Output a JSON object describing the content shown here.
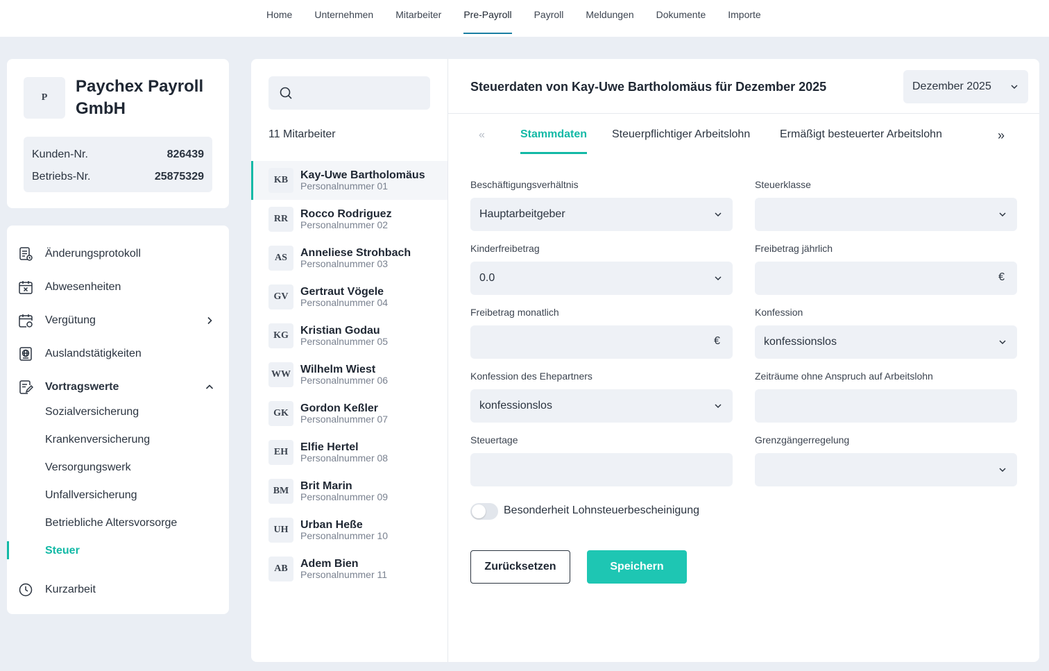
{
  "topnav": {
    "items": [
      "Home",
      "Unternehmen",
      "Mitarbeiter",
      "Pre-Payroll",
      "Payroll",
      "Meldungen",
      "Dokumente",
      "Importe"
    ],
    "active": "Pre-Payroll"
  },
  "company": {
    "logo_letter": "P",
    "name": "Paychex Payroll GmbH",
    "kunden_label": "Kunden-Nr.",
    "kunden_value": "826439",
    "betriebs_label": "Betriebs-Nr.",
    "betriebs_value": "25875329"
  },
  "side_menu": {
    "items": {
      "aenderung": "Änderungsprotokoll",
      "abwesenheiten": "Abwesenheiten",
      "verguetung": "Vergütung",
      "ausland": "Auslandstätigkeiten",
      "vortragswerte": "Vortragswerte",
      "kurzarbeit": "Kurzarbeit"
    },
    "sub_items": [
      "Sozialversicherung",
      "Krankenversicherung",
      "Versorgungswerk",
      "Unfallversicherung",
      "Betriebliche Altersvorsorge",
      "Steuer"
    ],
    "active_sub": "Steuer"
  },
  "employees": {
    "search_placeholder": "",
    "count_label": "11 Mitarbeiter",
    "list": [
      {
        "initials": "KB",
        "name": "Kay-Uwe Bartholomäus",
        "number": "Personalnummer 01"
      },
      {
        "initials": "RR",
        "name": "Rocco Rodriguez",
        "number": "Personalnummer 02"
      },
      {
        "initials": "AS",
        "name": "Anneliese Strohbach",
        "number": "Personalnummer 03"
      },
      {
        "initials": "GV",
        "name": "Gertraut Vögele",
        "number": "Personalnummer 04"
      },
      {
        "initials": "KG",
        "name": "Kristian Godau",
        "number": "Personalnummer 05"
      },
      {
        "initials": "WW",
        "name": "Wilhelm Wiest",
        "number": "Personalnummer 06"
      },
      {
        "initials": "GK",
        "name": "Gordon Keßler",
        "number": "Personalnummer 07"
      },
      {
        "initials": "EH",
        "name": "Elfie Hertel",
        "number": "Personalnummer 08"
      },
      {
        "initials": "BM",
        "name": "Brit Marin",
        "number": "Personalnummer 09"
      },
      {
        "initials": "UH",
        "name": "Urban Heße",
        "number": "Personalnummer 10"
      },
      {
        "initials": "AB",
        "name": "Adem Bien",
        "number": "Personalnummer 11"
      }
    ]
  },
  "main": {
    "title": "Steuerdaten von Kay-Uwe Bartholomäus für Dezember 2025",
    "month": "Dezember 2025",
    "tabs_prev": "«",
    "tabs_next": "»",
    "tabs": [
      "Stammdaten",
      "Steuerpflichtiger Arbeitslohn",
      "Ermäßigt besteuerter Arbeitslohn"
    ],
    "active_tab": "Stammdaten",
    "fields": {
      "beschaeftigung": {
        "label": "Beschäftigungsverhältnis",
        "value": "Hauptarbeitgeber"
      },
      "steuerklasse": {
        "label": "Steuerklasse",
        "value": ""
      },
      "kinderfreibetrag": {
        "label": "Kinderfreibetrag",
        "value": "0.0"
      },
      "freibetrag_jaehrlich": {
        "label": "Freibetrag jährlich",
        "value": "",
        "unit": "€"
      },
      "freibetrag_monatlich": {
        "label": "Freibetrag monatlich",
        "value": "",
        "unit": "€"
      },
      "konfession": {
        "label": "Konfession",
        "value": "konfessionslos"
      },
      "konfession_ehepartner": {
        "label": "Konfession des Ehepartners",
        "value": "konfessionslos"
      },
      "zeitraeume": {
        "label": "Zeiträume ohne Anspruch auf Arbeitslohn",
        "value": ""
      },
      "steuertage": {
        "label": "Steuertage",
        "value": ""
      },
      "grenzgaenger": {
        "label": "Grenzgängerregelung",
        "value": ""
      }
    },
    "toggle_label": "Besonderheit Lohnsteuerbescheinigung",
    "toggle_on": false,
    "reset_label": "Zurücksetzen",
    "save_label": "Speichern",
    "accent_color": "#13b9a6"
  }
}
